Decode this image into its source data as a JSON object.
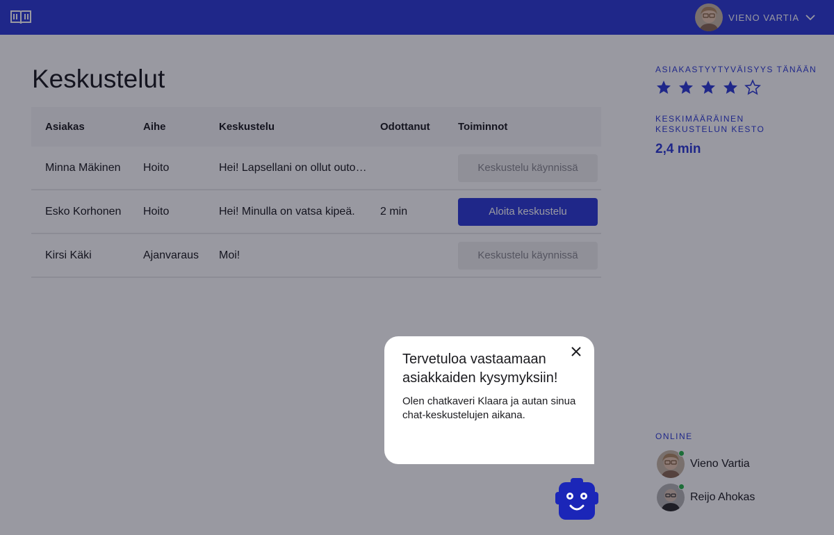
{
  "header": {
    "logo_icon": "open-book-icon",
    "user_name": "VIENO VARTIA",
    "menu_icon": "chevron-down-icon"
  },
  "page": {
    "title": "Keskustelut"
  },
  "table": {
    "columns": [
      "Asiakas",
      "Aihe",
      "Keskustelu",
      "Odottanut",
      "Toiminnot"
    ],
    "rows": [
      {
        "customer": "Minna Mäkinen",
        "topic": "Hoito",
        "conversation": "Hei! Lapsellani on ollut outo…",
        "waited": "",
        "action": "Keskustelu käynnissä",
        "action_state": "disabled"
      },
      {
        "customer": "Esko Korhonen",
        "topic": "Hoito",
        "conversation": "Hei! Minulla on vatsa kipeä.",
        "waited": "2 min",
        "action": "Aloita keskustelu",
        "action_state": "primary"
      },
      {
        "customer": "Kirsi Käki",
        "topic": "Ajanvaraus",
        "conversation": "Moi!",
        "waited": "",
        "action": "Keskustelu käynnissä",
        "action_state": "disabled"
      }
    ]
  },
  "sidebar": {
    "satisfaction_label": "ASIAKASTYYTYVÄISYYS TÄNÄÄN",
    "satisfaction_rating": 4,
    "satisfaction_max": 5,
    "avg_duration_label_line1": "KESKIMÄÄRÄINEN",
    "avg_duration_label_line2": "KESKUSTELUN KESTO",
    "avg_duration_value": "2,4 min",
    "online_label": "ONLINE",
    "online_users": [
      {
        "name": "Vieno Vartia",
        "status": "online"
      },
      {
        "name": "Reijo Ahokas",
        "status": "online"
      }
    ]
  },
  "popup": {
    "title": "Tervetuloa vastaamaan asiakkaiden kysymyksiin!",
    "body": "Olen chatkaveri Klaara ja autan sinua chat-keskustelujen aikana.",
    "close_icon": "close-icon",
    "bot_icon": "robot-assistant-icon"
  },
  "colors": {
    "primary": "#2e3bd6",
    "online": "#28b34b",
    "overlay": "rgba(12,12,30,0.42)"
  }
}
